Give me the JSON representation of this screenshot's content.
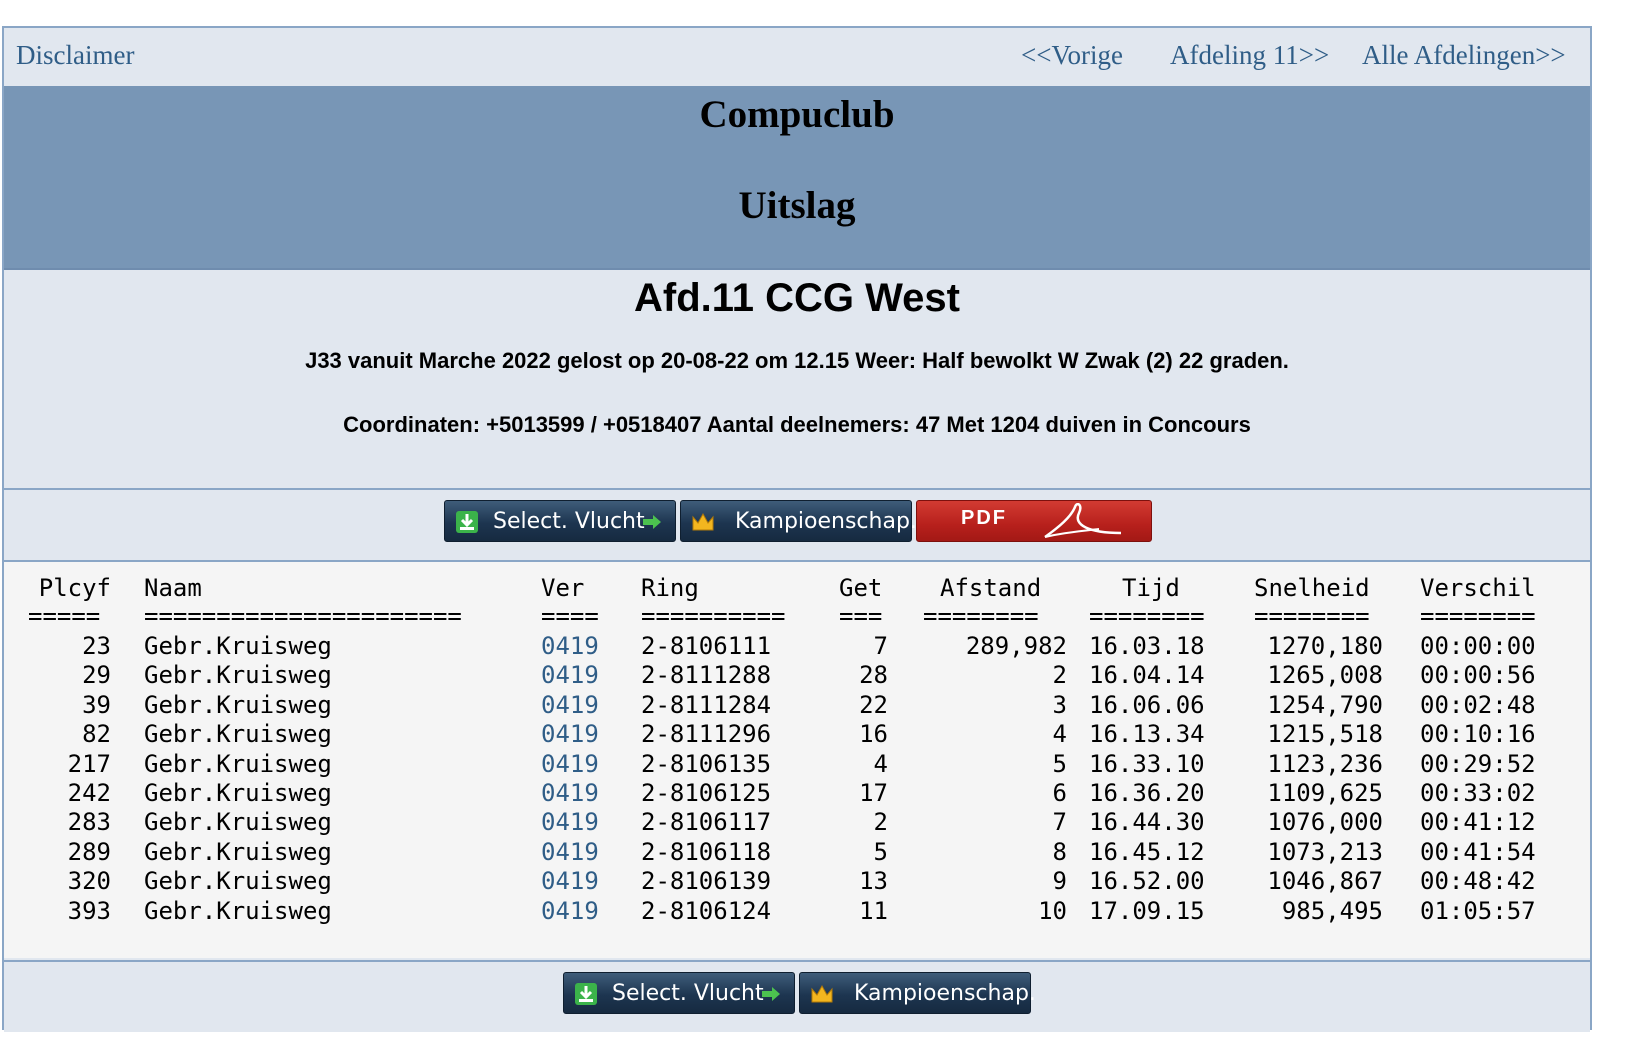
{
  "nav": {
    "disclaimer": "Disclaimer",
    "prev": "<<Vorige",
    "next": "Afdeling 11>>",
    "all": "Alle Afdelingen>>"
  },
  "banner": {
    "club": "Compuclub",
    "subtitle": "Uitslag"
  },
  "info": {
    "afdeling": "Afd.11 CCG West",
    "flight_line": "J33 vanuit Marche 2022 gelost op 20-08-22 om 12.15 Weer: Half bewolkt W Zwak (2) 22 graden.",
    "coords_line": "Coordinaten: +5013599 / +0518407 Aantal deelnemers: 47 Met 1204 duiven in Concours"
  },
  "buttons": {
    "select_vlucht": "Select. Vlucht",
    "kampioenschap": "Kampioenschap.",
    "pdf": "PDF"
  },
  "colors": {
    "banner": "#7896b6",
    "panel": "#e1e7ef",
    "link": "#2f5d87",
    "pdf_red": "#b7201c"
  },
  "table": {
    "headers": {
      "plcyf": "Plcyf",
      "naam": "Naam",
      "ver": "Ver",
      "ring": "Ring",
      "get": "Get",
      "afstand": "Afstand",
      "tijd": "Tijd",
      "snelheid": "Snelheid",
      "verschil": "Verschil"
    },
    "separators": {
      "plcyf": "=====",
      "naam": "======================",
      "ver": "====",
      "ring": "==========",
      "get": "===",
      "afstand": "========",
      "tijd": "========",
      "snelheid": "========",
      "verschil": "========"
    },
    "rows": [
      {
        "plcyf": "23",
        "naam": "Gebr.Kruisweg",
        "ver": "0419",
        "ring": "2-8106111",
        "get": "7",
        "afstand": "289,982",
        "tijd": "16.03.18",
        "snelheid": "1270,180",
        "verschil": "00:00:00"
      },
      {
        "plcyf": "29",
        "naam": "Gebr.Kruisweg",
        "ver": "0419",
        "ring": "2-8111288",
        "get": "28",
        "afstand": "2",
        "tijd": "16.04.14",
        "snelheid": "1265,008",
        "verschil": "00:00:56"
      },
      {
        "plcyf": "39",
        "naam": "Gebr.Kruisweg",
        "ver": "0419",
        "ring": "2-8111284",
        "get": "22",
        "afstand": "3",
        "tijd": "16.06.06",
        "snelheid": "1254,790",
        "verschil": "00:02:48"
      },
      {
        "plcyf": "82",
        "naam": "Gebr.Kruisweg",
        "ver": "0419",
        "ring": "2-8111296",
        "get": "16",
        "afstand": "4",
        "tijd": "16.13.34",
        "snelheid": "1215,518",
        "verschil": "00:10:16"
      },
      {
        "plcyf": "217",
        "naam": "Gebr.Kruisweg",
        "ver": "0419",
        "ring": "2-8106135",
        "get": "4",
        "afstand": "5",
        "tijd": "16.33.10",
        "snelheid": "1123,236",
        "verschil": "00:29:52"
      },
      {
        "plcyf": "242",
        "naam": "Gebr.Kruisweg",
        "ver": "0419",
        "ring": "2-8106125",
        "get": "17",
        "afstand": "6",
        "tijd": "16.36.20",
        "snelheid": "1109,625",
        "verschil": "00:33:02"
      },
      {
        "plcyf": "283",
        "naam": "Gebr.Kruisweg",
        "ver": "0419",
        "ring": "2-8106117",
        "get": "2",
        "afstand": "7",
        "tijd": "16.44.30",
        "snelheid": "1076,000",
        "verschil": "00:41:12"
      },
      {
        "plcyf": "289",
        "naam": "Gebr.Kruisweg",
        "ver": "0419",
        "ring": "2-8106118",
        "get": "5",
        "afstand": "8",
        "tijd": "16.45.12",
        "snelheid": "1073,213",
        "verschil": "00:41:54"
      },
      {
        "plcyf": "320",
        "naam": "Gebr.Kruisweg",
        "ver": "0419",
        "ring": "2-8106139",
        "get": "13",
        "afstand": "9",
        "tijd": "16.52.00",
        "snelheid": "1046,867",
        "verschil": "00:48:42"
      },
      {
        "plcyf": "393",
        "naam": "Gebr.Kruisweg",
        "ver": "0419",
        "ring": "2-8106124",
        "get": "11",
        "afstand": "10",
        "tijd": "17.09.15",
        "snelheid": "985,495",
        "verschil": "01:05:57"
      }
    ]
  }
}
